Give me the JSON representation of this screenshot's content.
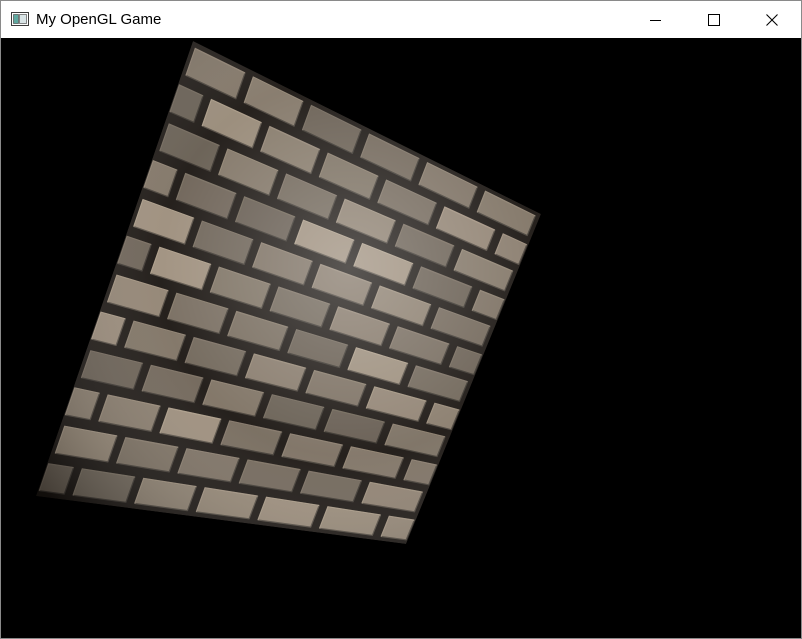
{
  "window": {
    "title": "My OpenGL Game",
    "buttons": {
      "minimize": "minimize-icon",
      "maximize": "maximize-icon",
      "close": "close-icon"
    }
  },
  "scene": {
    "background_color": "#000000",
    "object": "textured-quad",
    "texture": "stone-brick-wall",
    "brick_color": "#8a7d6d",
    "mortar_color": "#1a1511"
  }
}
